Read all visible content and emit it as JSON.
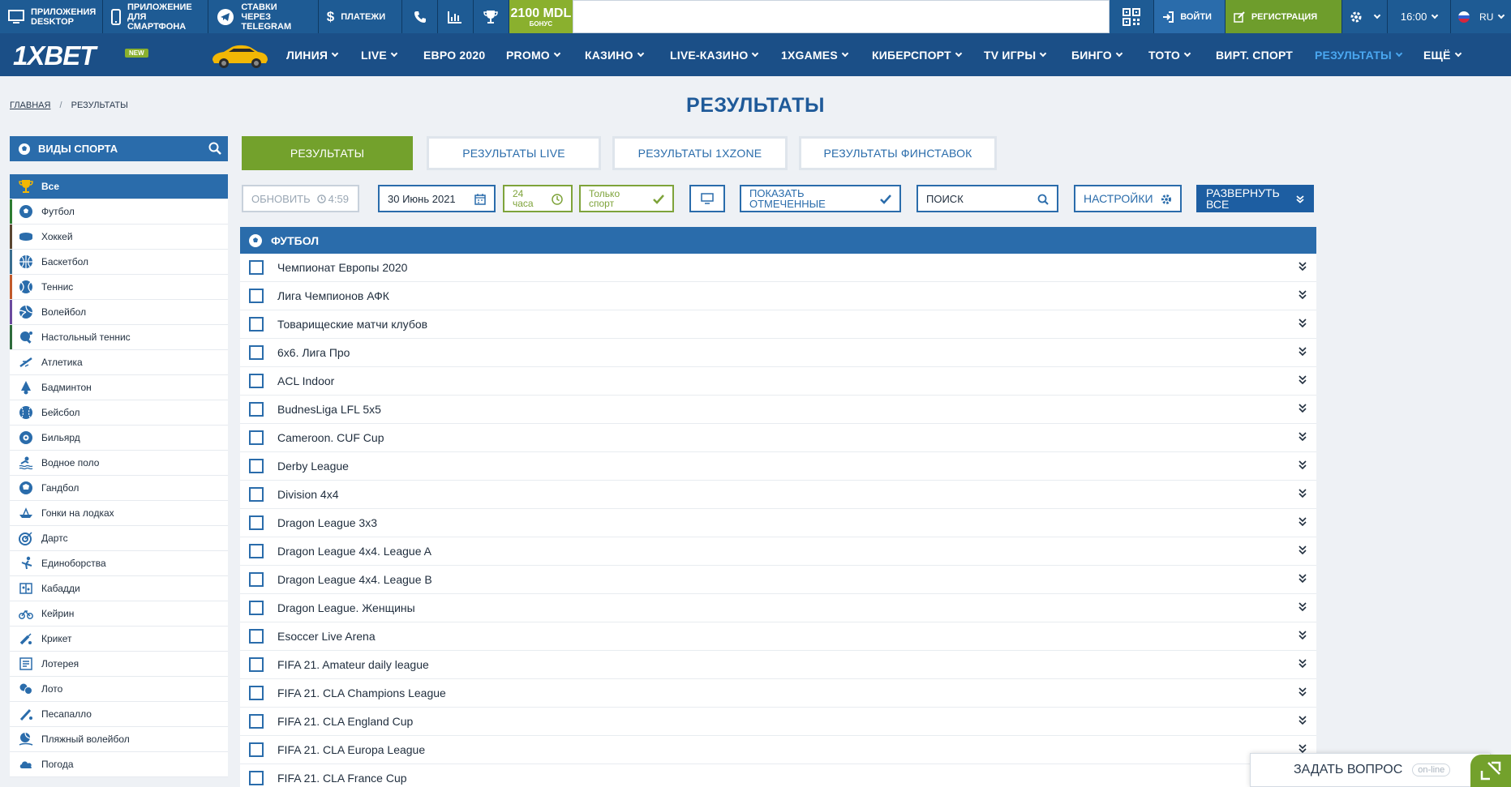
{
  "topbar": {
    "desktop_line1": "ПРИЛОЖЕНИЯ",
    "desktop_line2": "DESKTOP",
    "phone_line1": "ПРИЛОЖЕНИЕ",
    "phone_line2": "ДЛЯ СМАРТФОНА",
    "telegram_line1": "СТАВКИ",
    "telegram_line2": "ЧЕРЕЗ TELEGRAM",
    "payments": "ПЛАТЕЖИ",
    "bonus_amount": "2100 MDL",
    "bonus_label": "БОНУС",
    "login": "ВОЙТИ",
    "register": "РЕГИСТРАЦИЯ",
    "time": "16:00",
    "lang": "RU"
  },
  "nav": {
    "logo": "1XBET",
    "logo_badge": "NEW",
    "items": [
      "ЛИНИЯ",
      "LIVE",
      "ЕВРО 2020",
      "PROMO",
      "КАЗИНО",
      "LIVE-КАЗИНО",
      "1XGAMES",
      "КИБЕРСПОРТ",
      "TV ИГРЫ",
      "БИНГО",
      "ТОТО",
      "ВИРТ. СПОРТ",
      "РЕЗУЛЬТАТЫ",
      "ЕЩЁ"
    ]
  },
  "breadcrumb": {
    "home": "ГЛАВНАЯ",
    "separator": "/",
    "current": "РЕЗУЛЬТАТЫ"
  },
  "page_title": "РЕЗУЛЬТАТЫ",
  "sidebar": {
    "title": "ВИДЫ СПОРТА",
    "items": [
      "Все",
      "Футбол",
      "Хоккей",
      "Баскетбол",
      "Теннис",
      "Волейбол",
      "Настольный теннис",
      "Атлетика",
      "Бадминтон",
      "Бейсбол",
      "Бильярд",
      "Водное поло",
      "Гандбол",
      "Гонки на лодках",
      "Дартс",
      "Единоборства",
      "Кабадди",
      "Кейрин",
      "Крикет",
      "Лотерея",
      "Лото",
      "Песапалло",
      "Пляжный волейбол",
      "Погода"
    ]
  },
  "tabs": [
    "РЕЗУЛЬТАТЫ",
    "РЕЗУЛЬТАТЫ LIVE",
    "РЕЗУЛЬТАТЫ 1XZONE",
    "РЕЗУЛЬТАТЫ ФИНСТАВОК"
  ],
  "toolbar": {
    "refresh": "ОБНОВИТЬ",
    "refresh_timer": "4:59",
    "date": "30 Июнь 2021",
    "hours_line1": "24",
    "hours_line2": "часа",
    "only_sport_line1": "Только",
    "only_sport_line2": "спорт",
    "show_cancelled_line1": "ПОКАЗАТЬ",
    "show_cancelled_line2": "ОТМЕЧЕННЫЕ",
    "search_placeholder": "ПОИСК",
    "settings": "НАСТРОЙКИ",
    "expand_line1": "РАЗВЕРНУТЬ",
    "expand_line2": "ВСЕ"
  },
  "panel": {
    "sport": "ФУТБОЛ",
    "leagues": [
      "Чемпионат Европы 2020",
      "Лига Чемпионов АФК",
      "Товарищеские матчи клубов",
      "6х6. Лига Про",
      "ACL Indoor",
      "BudnesLiga LFL 5x5",
      "Cameroon. CUF Cup",
      "Derby League",
      "Division 4x4",
      "Dragon League 3x3",
      "Dragon League 4x4. League A",
      "Dragon League 4x4. League B",
      "Dragon League. Женщины",
      "Esoccer Live Arena",
      "FIFA 21. Amateur daily league",
      "FIFA 21. CLA Champions League",
      "FIFA 21. CLA England Cup",
      "FIFA 21. CLA Europa League",
      "FIFA 21. CLA France Cup"
    ]
  },
  "ask": {
    "label": "ЗАДАТЬ ВОПРОС",
    "status": "on-line"
  },
  "colors": {
    "primary": "#2a6cab",
    "nav": "#1b4f87",
    "accent_green": "#73a12c",
    "active_nav": "#4aa7f0"
  }
}
